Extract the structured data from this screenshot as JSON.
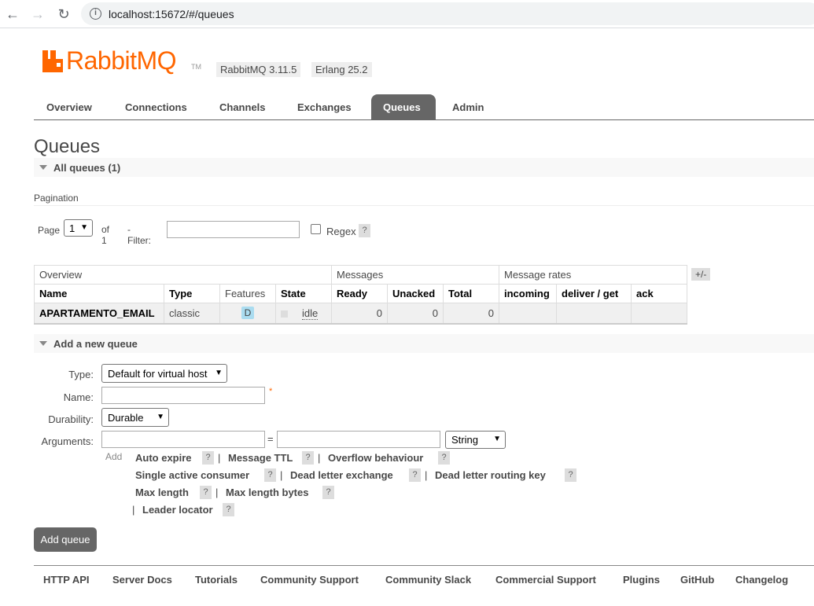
{
  "browser": {
    "url": "localhost:15672/#/queues"
  },
  "brand": {
    "name": "Rabbit",
    "name_suffix": "MQ",
    "tm": "TM",
    "rabbitmq_version": "RabbitMQ 3.11.5",
    "erlang_version": "Erlang 25.2",
    "color": "#ff6600"
  },
  "tabs": [
    {
      "label": "Overview",
      "active": false
    },
    {
      "label": "Connections",
      "active": false
    },
    {
      "label": "Channels",
      "active": false
    },
    {
      "label": "Exchanges",
      "active": false
    },
    {
      "label": "Queues",
      "active": true
    },
    {
      "label": "Admin",
      "active": false
    }
  ],
  "page_title": "Queues",
  "all_queues": {
    "label": "All queues (1)"
  },
  "pagination": {
    "label": "Pagination",
    "page_label": "Page",
    "page_value": "1",
    "of_label": "of 1",
    "filter_label": "- Filter:",
    "filter_value": "",
    "regex_label": "Regex",
    "help": "?"
  },
  "table": {
    "groups": [
      "Overview",
      "Messages",
      "Message rates"
    ],
    "toggle_label": "+/-",
    "headers": [
      "Name",
      "Type",
      "Features",
      "State",
      "Ready",
      "Unacked",
      "Total",
      "incoming",
      "deliver / get",
      "ack"
    ],
    "rows": [
      {
        "name": "APARTAMENTO_EMAIL",
        "type": "classic",
        "features": "D",
        "state": "idle",
        "ready": "0",
        "unacked": "0",
        "total": "0",
        "incoming": "",
        "deliver_get": "",
        "ack": ""
      }
    ]
  },
  "add_queue": {
    "section_label": "Add a new queue",
    "type_label": "Type:",
    "type_value": "Default for virtual host",
    "name_label": "Name:",
    "name_value": "",
    "required_mark": "*",
    "durability_label": "Durability:",
    "durability_value": "Durable",
    "arguments_label": "Arguments:",
    "arg_key_value": "",
    "arg_equals": "=",
    "arg_value_value": "",
    "arg_type_value": "String",
    "add_label": "Add",
    "arg_links": [
      "Auto expire",
      "Message TTL",
      "Overflow behaviour",
      "Single active consumer",
      "Dead letter exchange",
      "Dead letter routing key",
      "Max length",
      "Max length bytes",
      "Leader locator"
    ],
    "separator": "|",
    "help": "?",
    "submit_label": "Add queue"
  },
  "footer": [
    "HTTP API",
    "Server Docs",
    "Tutorials",
    "Community Support",
    "Community Slack",
    "Commercial Support",
    "Plugins",
    "GitHub",
    "Changelog"
  ]
}
